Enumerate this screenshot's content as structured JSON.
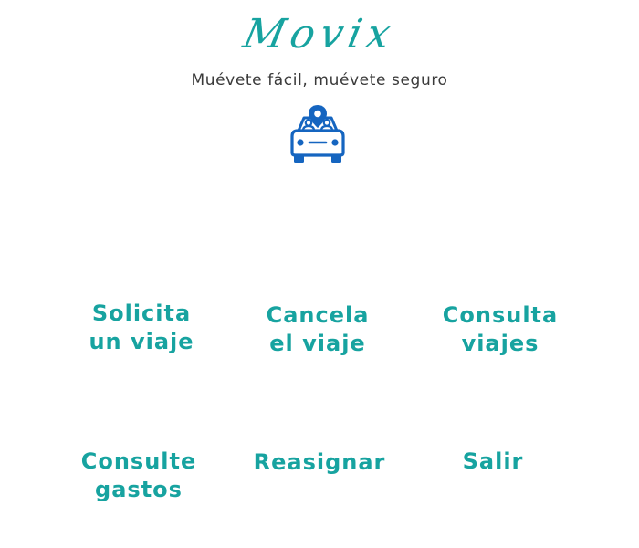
{
  "header": {
    "brand": "Movix",
    "tagline": "Muévete fácil, muévete seguro",
    "logo_icon": "car-location-pin-icon"
  },
  "colors": {
    "accent": "#17a3a0",
    "tagline": "#3a3a3a",
    "logo": "#1565c0"
  },
  "menu": {
    "solicita": "Solicita\nun viaje",
    "cancela": "Cancela\nel viaje",
    "consulta_viajes": "Consulta\nviajes",
    "consulte_gastos": "Consulte\ngastos",
    "reasignar": "Reasignar",
    "salir": "Salir"
  }
}
